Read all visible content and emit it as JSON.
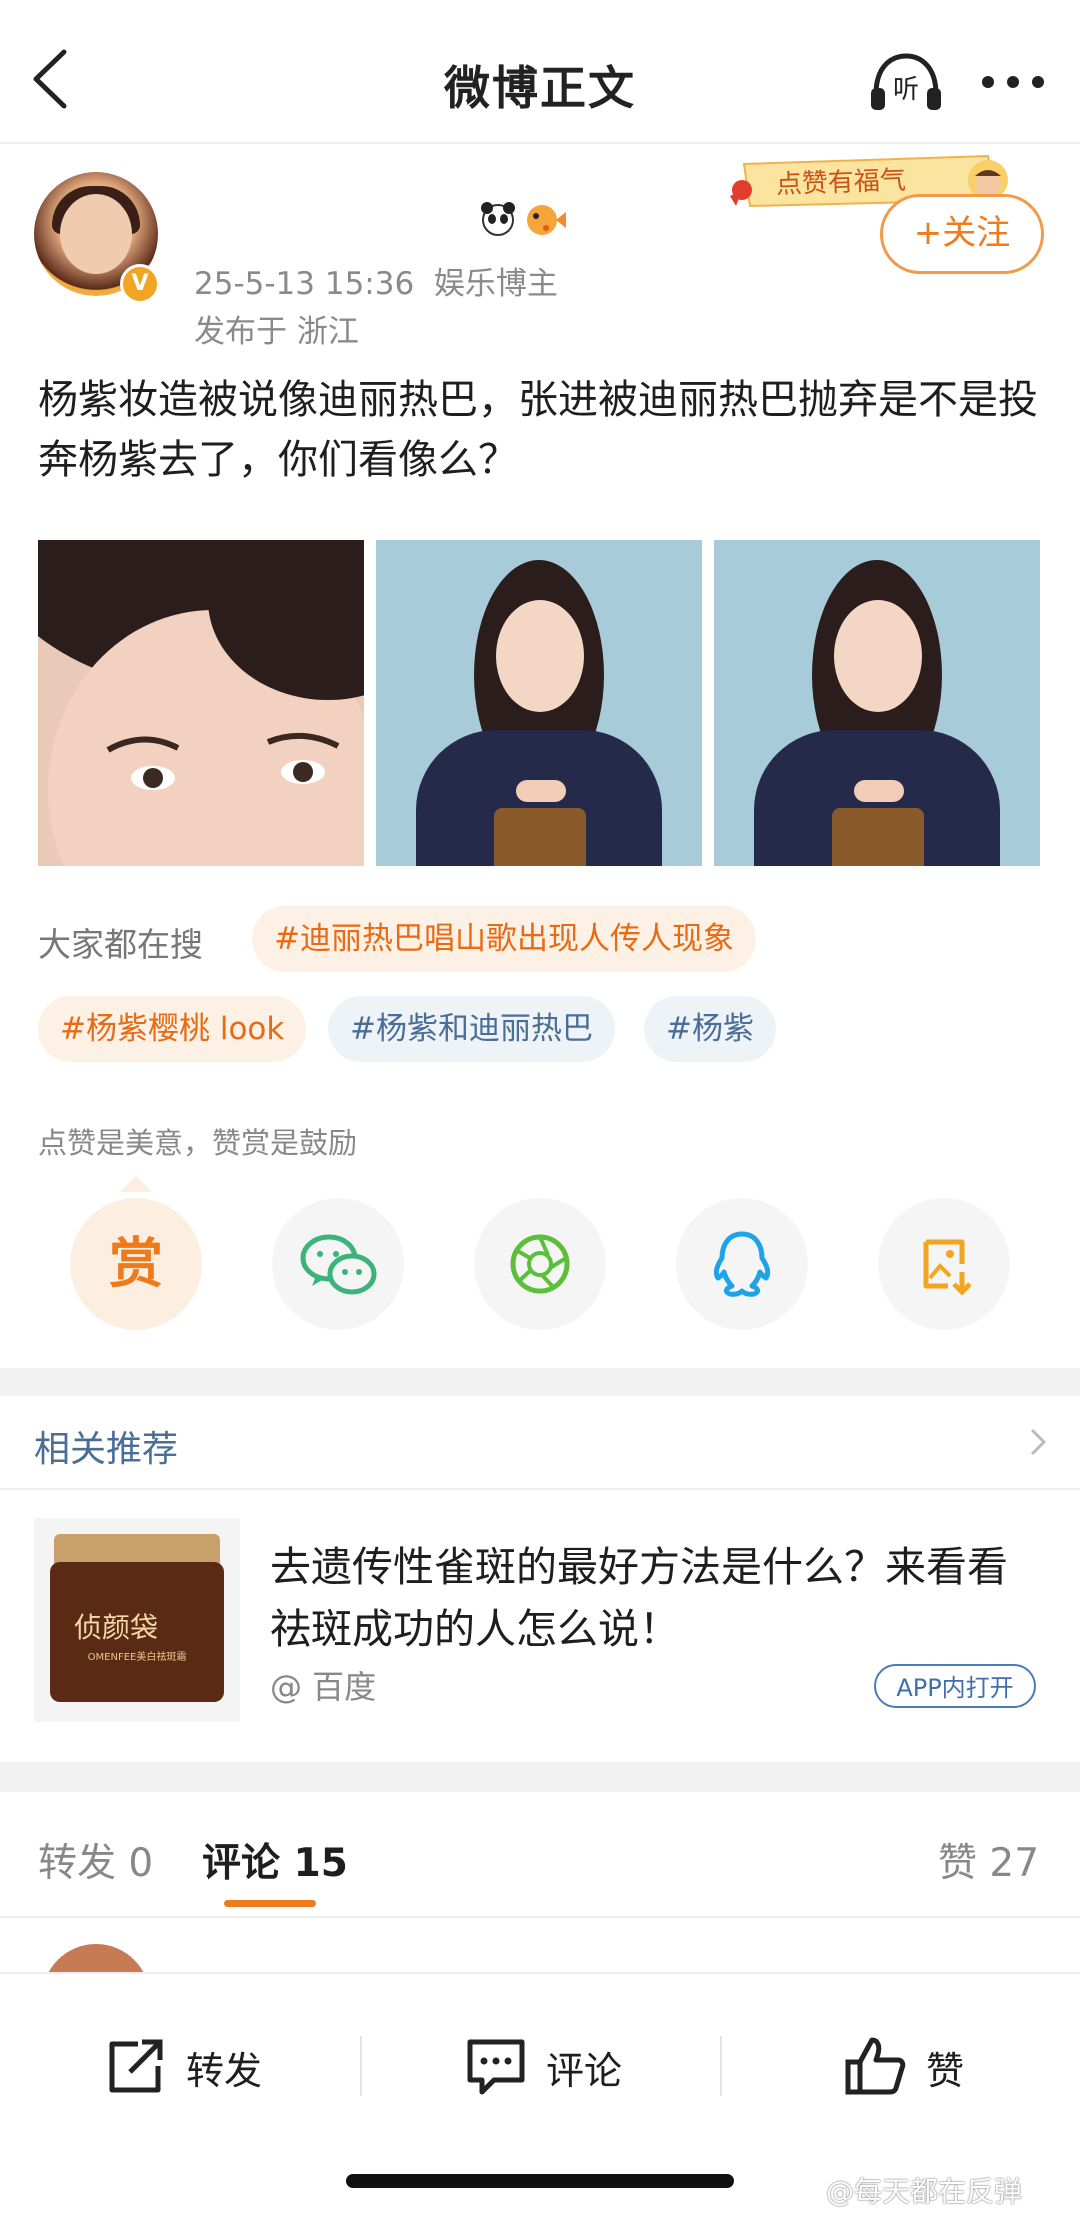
{
  "nav": {
    "title": "微博正文",
    "listen_label": "听"
  },
  "post": {
    "datetime": "25-5-13 15:36",
    "author_type": "娱乐博主",
    "location": "发布于 浙江",
    "fortune_badge": "点赞有福气",
    "follow_label": "+关注",
    "content": "杨紫妆造被说像迪丽热巴，张进被迪丽热巴抛弃是不是投奔杨紫去了，你们看像么？",
    "verified_mark": "V"
  },
  "search": {
    "label": "大家都在搜",
    "tags": [
      "#迪丽热巴唱山歌出现人传人现象",
      "#杨紫樱桃 look",
      "#杨紫和迪丽热巴",
      "#杨紫"
    ]
  },
  "reward": {
    "text": "点赞是美意，赞赏是鼓励",
    "glyph": "赏"
  },
  "related": {
    "title": "相关推荐",
    "ad_title": "去遗传性雀斑的最好方法是什么？来看看祛斑成功的人怎么说！",
    "ad_source": "@ 百度",
    "ad_button": "APP内打开",
    "ad_brand": "侦颜袋",
    "ad_brand_sub": "OMENFEE美白祛斑霜"
  },
  "tabs": {
    "repost": "转发 0",
    "comments": "评论 15",
    "likes": "赞 27"
  },
  "toolbar": {
    "repost": "转发",
    "comment": "评论",
    "like": "赞"
  },
  "watermark": "@每天都在反弹",
  "colors": {
    "accent": "#f07b1d",
    "link_blue": "#4b6e97",
    "wechat_green": "#3cb37a",
    "qq_blue": "#1fa2e8"
  }
}
